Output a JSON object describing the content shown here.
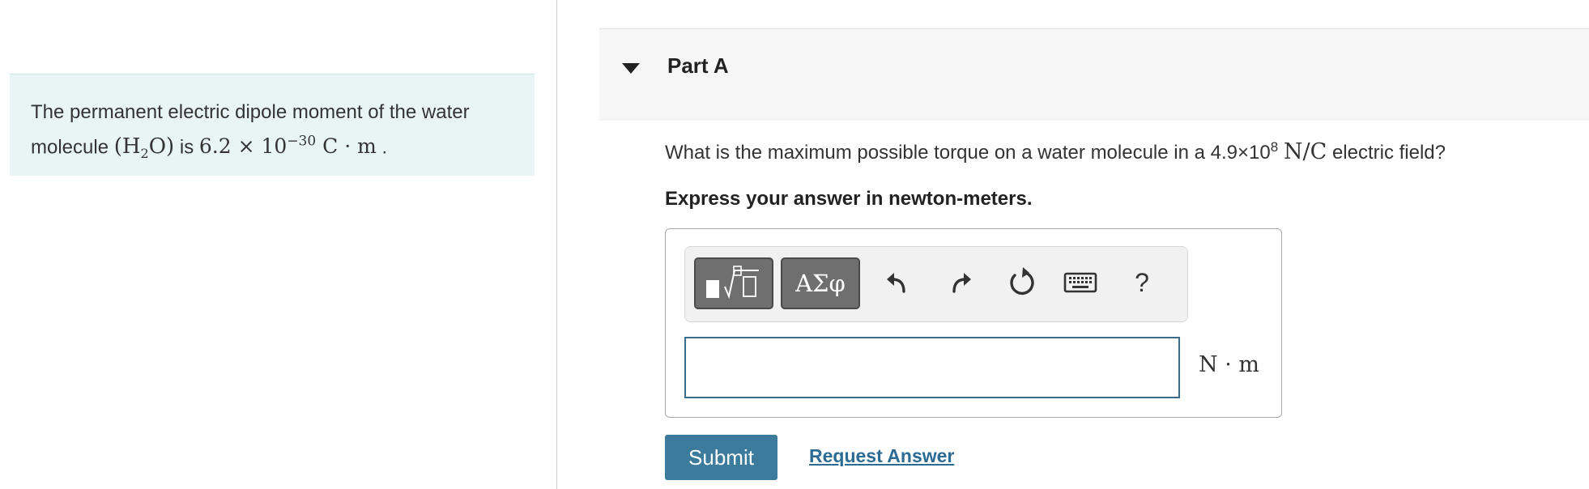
{
  "intro": {
    "line1": "The permanent electric dipole moment of the water",
    "line2_prefix": "molecule",
    "molecule_formula_open": "(H",
    "molecule_formula_sub": "2",
    "molecule_formula_close": "O)",
    "line2_mid": "is",
    "moment_value": "6.2 × 10",
    "moment_exponent": "−30",
    "moment_unit": "C · m",
    "period": "."
  },
  "part": {
    "title": "Part A"
  },
  "question": {
    "prefix": "What is the maximum possible torque on a water molecule in a",
    "field_value": "4.9×10",
    "field_exponent": "8",
    "field_unit": "N/C",
    "suffix": "electric field?"
  },
  "instruction": "Express your answer in newton-meters.",
  "toolbar": {
    "templates_icon": "templates-root-icon",
    "symbols_label": "ΑΣφ",
    "undo_icon": "undo-icon",
    "redo_icon": "redo-icon",
    "reset_icon": "reset-icon",
    "keyboard_icon": "keyboard-icon",
    "help_label": "?"
  },
  "answer": {
    "value": "",
    "unit": "N · m"
  },
  "buttons": {
    "submit": "Submit",
    "request_answer": "Request Answer"
  },
  "colors": {
    "intro_bg": "#e9f5f5",
    "submit_bg": "#3d7b9c",
    "link": "#2c6b93",
    "input_border": "#3a6d8c"
  }
}
